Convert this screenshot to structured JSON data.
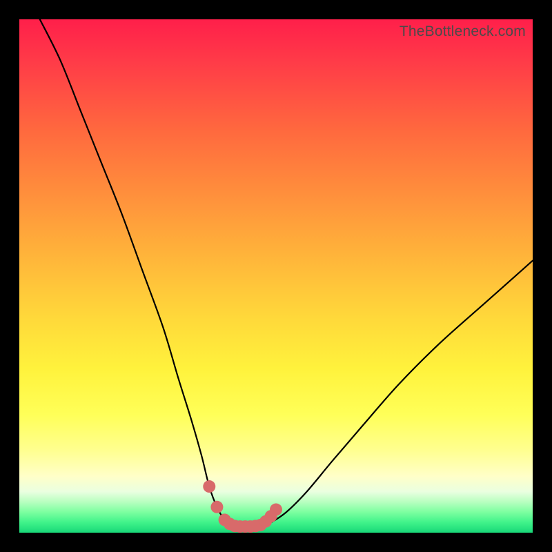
{
  "watermark": "TheBottleneck.com",
  "chart_data": {
    "type": "line",
    "title": "",
    "xlabel": "",
    "ylabel": "",
    "xlim": [
      0,
      100
    ],
    "ylim": [
      0,
      100
    ],
    "series": [
      {
        "name": "bottleneck-curve",
        "x": [
          4,
          8,
          12,
          16,
          20,
          24,
          28,
          31,
          33.5,
          35.5,
          37,
          38.5,
          40,
          41.5,
          43,
          45,
          47,
          49,
          52,
          56,
          61,
          67,
          74,
          82,
          91,
          100
        ],
        "y": [
          100,
          92,
          82,
          72,
          62,
          51,
          40,
          30,
          22,
          15,
          9,
          5,
          2.5,
          1.5,
          1.2,
          1.2,
          1.3,
          2,
          4,
          8,
          14,
          21,
          29,
          37,
          45,
          53
        ]
      }
    ],
    "markers": {
      "name": "highlight-dots",
      "color": "#d86a6a",
      "points": [
        {
          "x": 37.0,
          "y": 9.0
        },
        {
          "x": 38.5,
          "y": 5.0
        },
        {
          "x": 40.0,
          "y": 2.5
        },
        {
          "x": 41.0,
          "y": 1.7
        },
        {
          "x": 42.0,
          "y": 1.3
        },
        {
          "x": 43.0,
          "y": 1.2
        },
        {
          "x": 44.0,
          "y": 1.2
        },
        {
          "x": 45.0,
          "y": 1.2
        },
        {
          "x": 46.0,
          "y": 1.3
        },
        {
          "x": 47.0,
          "y": 1.5
        },
        {
          "x": 48.0,
          "y": 2.2
        },
        {
          "x": 49.0,
          "y": 3.2
        },
        {
          "x": 50.0,
          "y": 4.5
        }
      ]
    },
    "colors": {
      "curve": "#000000",
      "marker": "#d86a6a",
      "frame": "#000000"
    }
  }
}
